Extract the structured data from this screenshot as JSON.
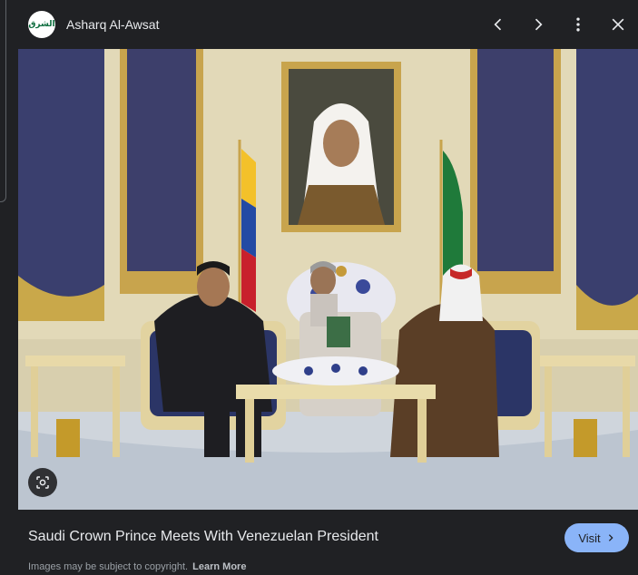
{
  "header": {
    "source_name": "Asharq Al-Awsat",
    "logo_text": "الشرق الاوسط",
    "prev_icon": "chevron-left-icon",
    "next_icon": "chevron-right-icon",
    "more_icon": "more-vert-icon",
    "close_icon": "close-icon"
  },
  "image": {
    "lens_icon": "lens-search-icon"
  },
  "footer": {
    "caption": "Saudi Crown Prince Meets With Venezuelan President",
    "copyright": "Images may be subject to copyright.",
    "learn_more": "Learn More",
    "visit_label": "Visit"
  },
  "colors": {
    "background": "#202124",
    "accent": "#8ab4f8"
  }
}
